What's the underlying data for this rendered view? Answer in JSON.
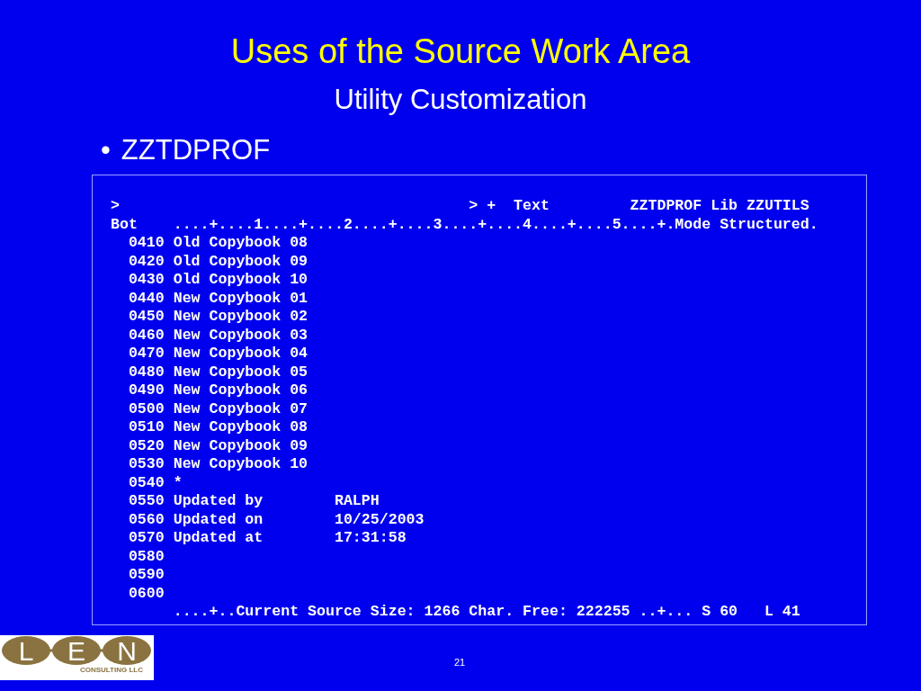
{
  "title": "Uses of the Source Work Area",
  "subtitle": "Utility Customization",
  "bullet": {
    "marker": "•",
    "text": "ZZTDPROF"
  },
  "terminal": {
    "lines": [
      ">                                       > +  Text         ZZTDPROF Lib ZZUTILS",
      "Bot    ....+....1....+....2....+....3....+....4....+....5....+.Mode Structured.",
      "  0410 Old Copybook 08",
      "  0420 Old Copybook 09",
      "  0430 Old Copybook 10",
      "  0440 New Copybook 01",
      "  0450 New Copybook 02",
      "  0460 New Copybook 03",
      "  0470 New Copybook 04",
      "  0480 New Copybook 05",
      "  0490 New Copybook 06",
      "  0500 New Copybook 07",
      "  0510 New Copybook 08",
      "  0520 New Copybook 09",
      "  0530 New Copybook 10",
      "  0540 *",
      "  0550 Updated by        RALPH",
      "  0560 Updated on        10/25/2003",
      "  0570 Updated at        17:31:58",
      "  0580",
      "  0590",
      "  0600",
      "       ....+..Current Source Size: 1266 Char. Free: 222255 ..+... S 60   L 41"
    ]
  },
  "logo": {
    "letters": [
      "L",
      "E",
      "N"
    ],
    "caption": "CONSULTING LLC"
  },
  "page_number": "21"
}
